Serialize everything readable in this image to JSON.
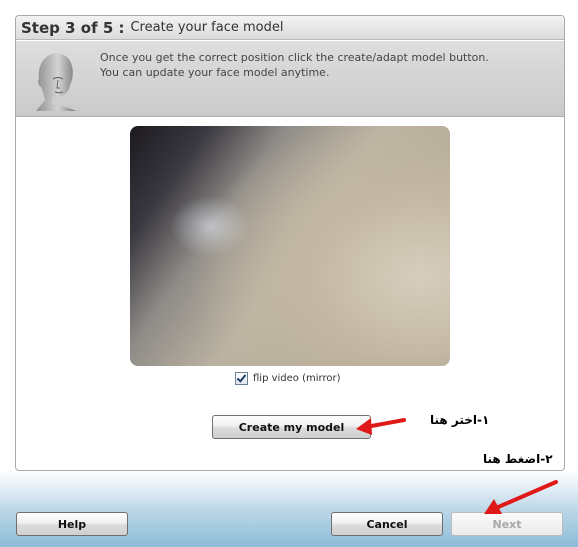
{
  "wizard": {
    "step_label": "Step 3 of 5 :",
    "step_title": "Create your face model",
    "instructions_line1": "Once you get the correct position click the create/adapt model button.",
    "instructions_line2": "You can update your face model anytime.",
    "head_icon": "face-model-head-icon"
  },
  "video": {
    "flip_label": "flip video (mirror)",
    "flip_checked": true
  },
  "buttons": {
    "create": "Create my model",
    "help": "Help",
    "cancel": "Cancel",
    "next": "Next",
    "next_enabled": false
  },
  "annotations": {
    "step1": "١-اختر هنا",
    "step2": "٢-اضغط هنا",
    "arrow_color": "#e01818"
  }
}
